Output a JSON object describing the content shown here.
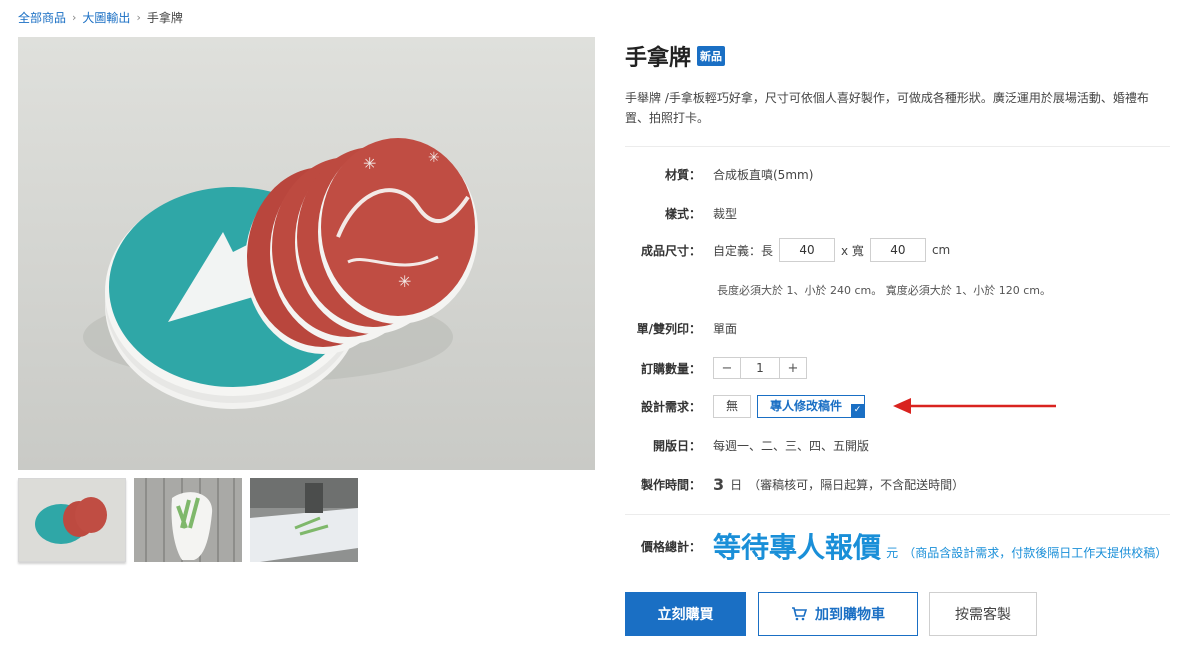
{
  "breadcrumb": {
    "items": [
      "全部商品",
      "大圖輸出",
      "手拿牌"
    ],
    "separator": "›"
  },
  "product": {
    "title": "手拿牌",
    "badge": "新品",
    "description": "手舉牌 /手拿板輕巧好拿，尺寸可依個人喜好製作，可做成各種形狀。廣泛運用於展場活動、婚禮布置、拍照打卡。"
  },
  "specs": {
    "material_label": "材質：",
    "material_value": "合成板直噴(5mm)",
    "style_label": "樣式：",
    "style_value": "裁型",
    "size_label": "成品尺寸：",
    "size_prefix": "自定義：長",
    "length_value": "40",
    "width_prefix": "x 寬",
    "width_value": "40",
    "unit": "cm",
    "size_hint": "長度必須大於 1、小於 240 cm。 寬度必須大於 1、小於 120 cm。",
    "print_label": "單/雙列印：",
    "print_value": "單面",
    "qty_label": "訂購數量：",
    "qty_minus": "−",
    "qty_value": "1",
    "qty_plus": "+",
    "design_label": "設計需求：",
    "design_options": [
      "無",
      "專人修改稿件"
    ],
    "design_check": "✓",
    "open_label": "開版日：",
    "open_value": "每週一、二、三、四、五開版",
    "time_label": "製作時間：",
    "time_days": "3",
    "time_unit": "日",
    "time_note": "（審稿核可，隔日起算，不含配送時間）"
  },
  "price": {
    "label": "價格總計：",
    "main": "等待專人報價",
    "unit": "元",
    "note": "（商品含設計需求，付款後隔日工作天提供校稿）"
  },
  "buttons": {
    "buy": "立刻購買",
    "cart": "加到購物車",
    "custom": "按需客製"
  },
  "colors": {
    "accent": "#1a6fc4",
    "price": "#1a8fd8",
    "arrow": "#d9231f"
  },
  "images": {
    "thumbnail_count": 3
  }
}
